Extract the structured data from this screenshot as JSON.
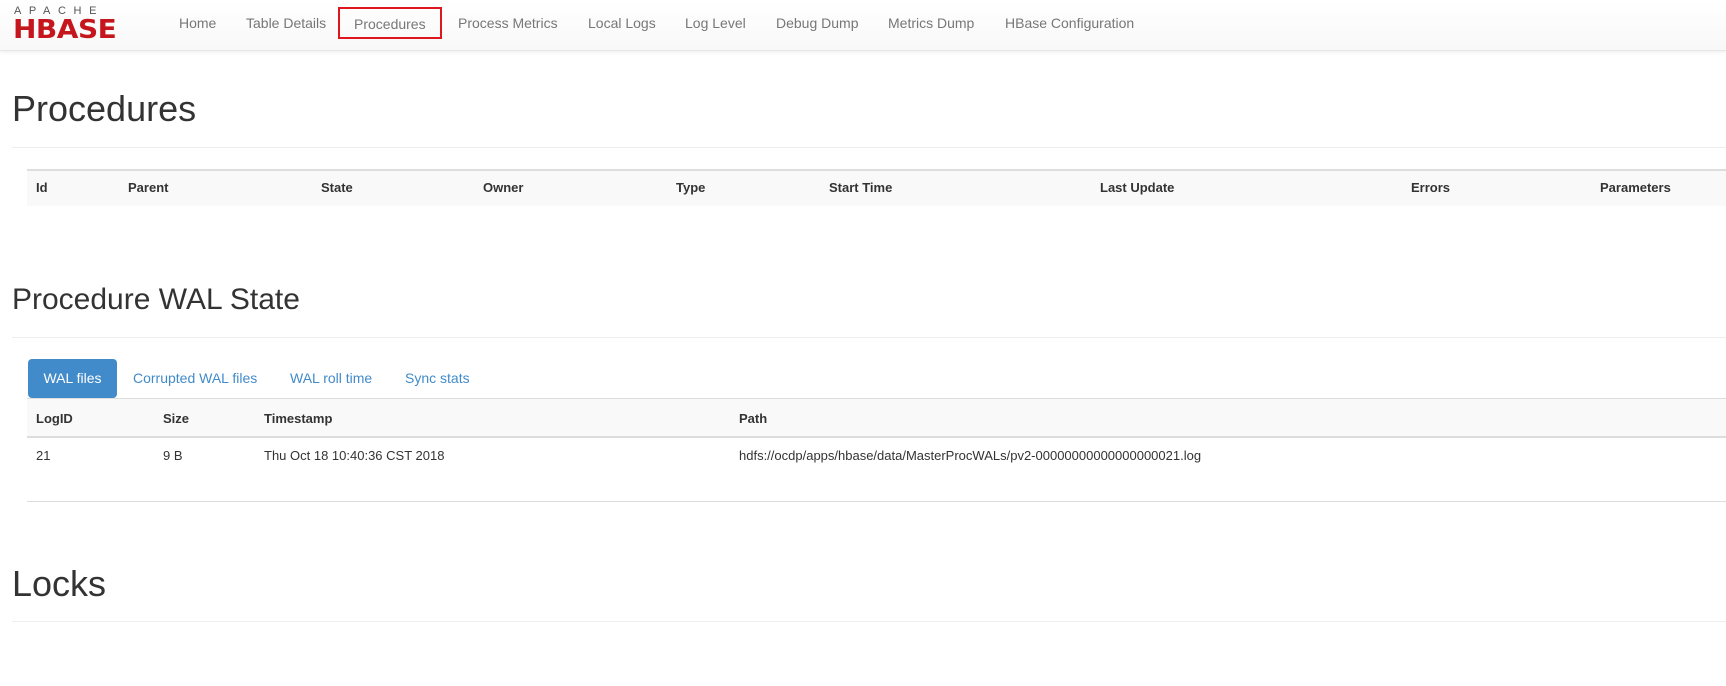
{
  "brand": {
    "top": "APACHE",
    "name": "HBASE"
  },
  "nav": {
    "items": [
      "Home",
      "Table Details",
      "Procedures",
      "Process Metrics",
      "Local Logs",
      "Log Level",
      "Debug Dump",
      "Metrics Dump",
      "HBase Configuration"
    ],
    "active": "Procedures",
    "highlight_color": "#e0161e"
  },
  "procedures": {
    "title": "Procedures",
    "columns": [
      "Id",
      "Parent",
      "State",
      "Owner",
      "Type",
      "Start Time",
      "Last Update",
      "Errors",
      "Parameters"
    ],
    "rows": []
  },
  "wal_state": {
    "title": "Procedure WAL State",
    "tabs": [
      "WAL files",
      "Corrupted WAL files",
      "WAL roll time",
      "Sync stats"
    ],
    "active_tab": "WAL files",
    "columns": [
      "LogID",
      "Size",
      "Timestamp",
      "Path"
    ],
    "rows": [
      [
        "21",
        "9 B",
        "Thu Oct 18 10:40:36 CST 2018",
        "hdfs://ocdp/apps/hbase/data/MasterProcWALs/pv2-00000000000000000021.log"
      ]
    ]
  },
  "locks": {
    "title": "Locks"
  },
  "colors": {
    "accent": "#428bca",
    "brand": "#c4161c"
  }
}
